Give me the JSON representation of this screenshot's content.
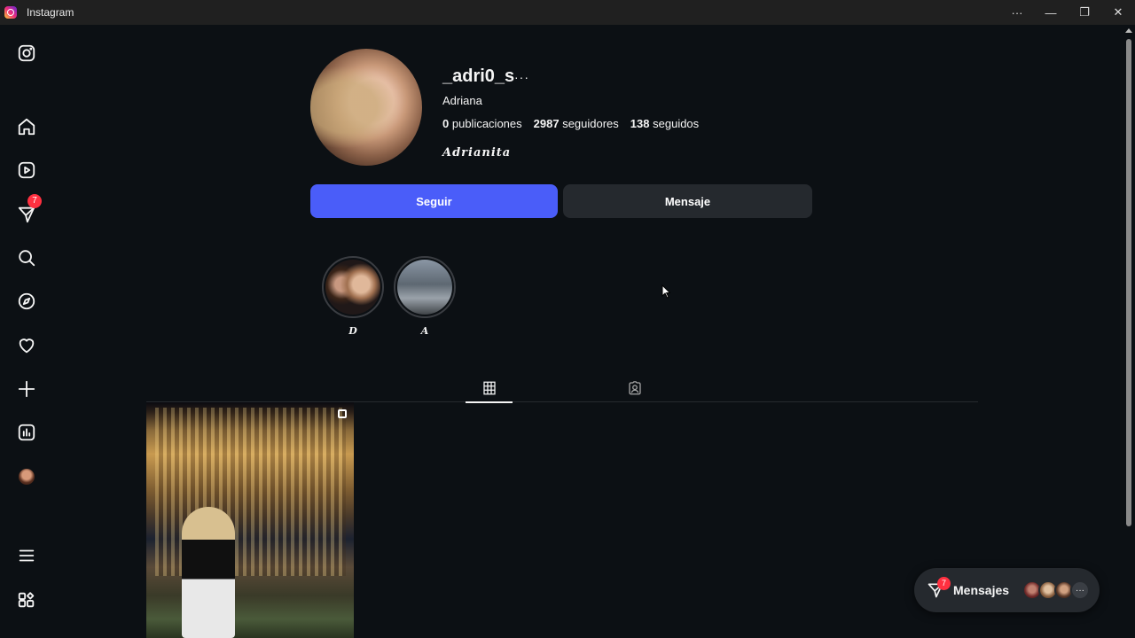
{
  "window": {
    "title": "Instagram",
    "controls": [
      "···",
      "—",
      "❐",
      "✕"
    ]
  },
  "leftnav": {
    "notification_badge": "7",
    "items": [
      "instagram-logo",
      "home",
      "reels",
      "messages",
      "search",
      "explore",
      "notifications",
      "create",
      "dashboard",
      "profile",
      "more",
      "also-from-meta"
    ]
  },
  "profile": {
    "username": "_adri0_s",
    "more": "···",
    "full_name": "Adriana",
    "posts_count": "0",
    "posts_label": "publicaciones",
    "followers_count": "2987",
    "followers_label": "seguidores",
    "following_count": "138",
    "following_label": "seguidos",
    "bio": "𝑨𝒅𝒓𝒊𝒂𝒏𝒊𝒕𝒂"
  },
  "buttons": {
    "follow": "Seguir",
    "message": "Mensaje"
  },
  "highlights": [
    {
      "label": "𝑫"
    },
    {
      "label": "𝑨"
    }
  ],
  "tabs": [
    "posts-grid",
    "tagged"
  ],
  "messages_pill": {
    "label": "Mensajes",
    "badge": "7",
    "more": "···"
  },
  "colors": {
    "background": "#0c1014",
    "follow_button": "#4a5df9",
    "message_button": "#25292e",
    "badge": "#ff3040"
  }
}
